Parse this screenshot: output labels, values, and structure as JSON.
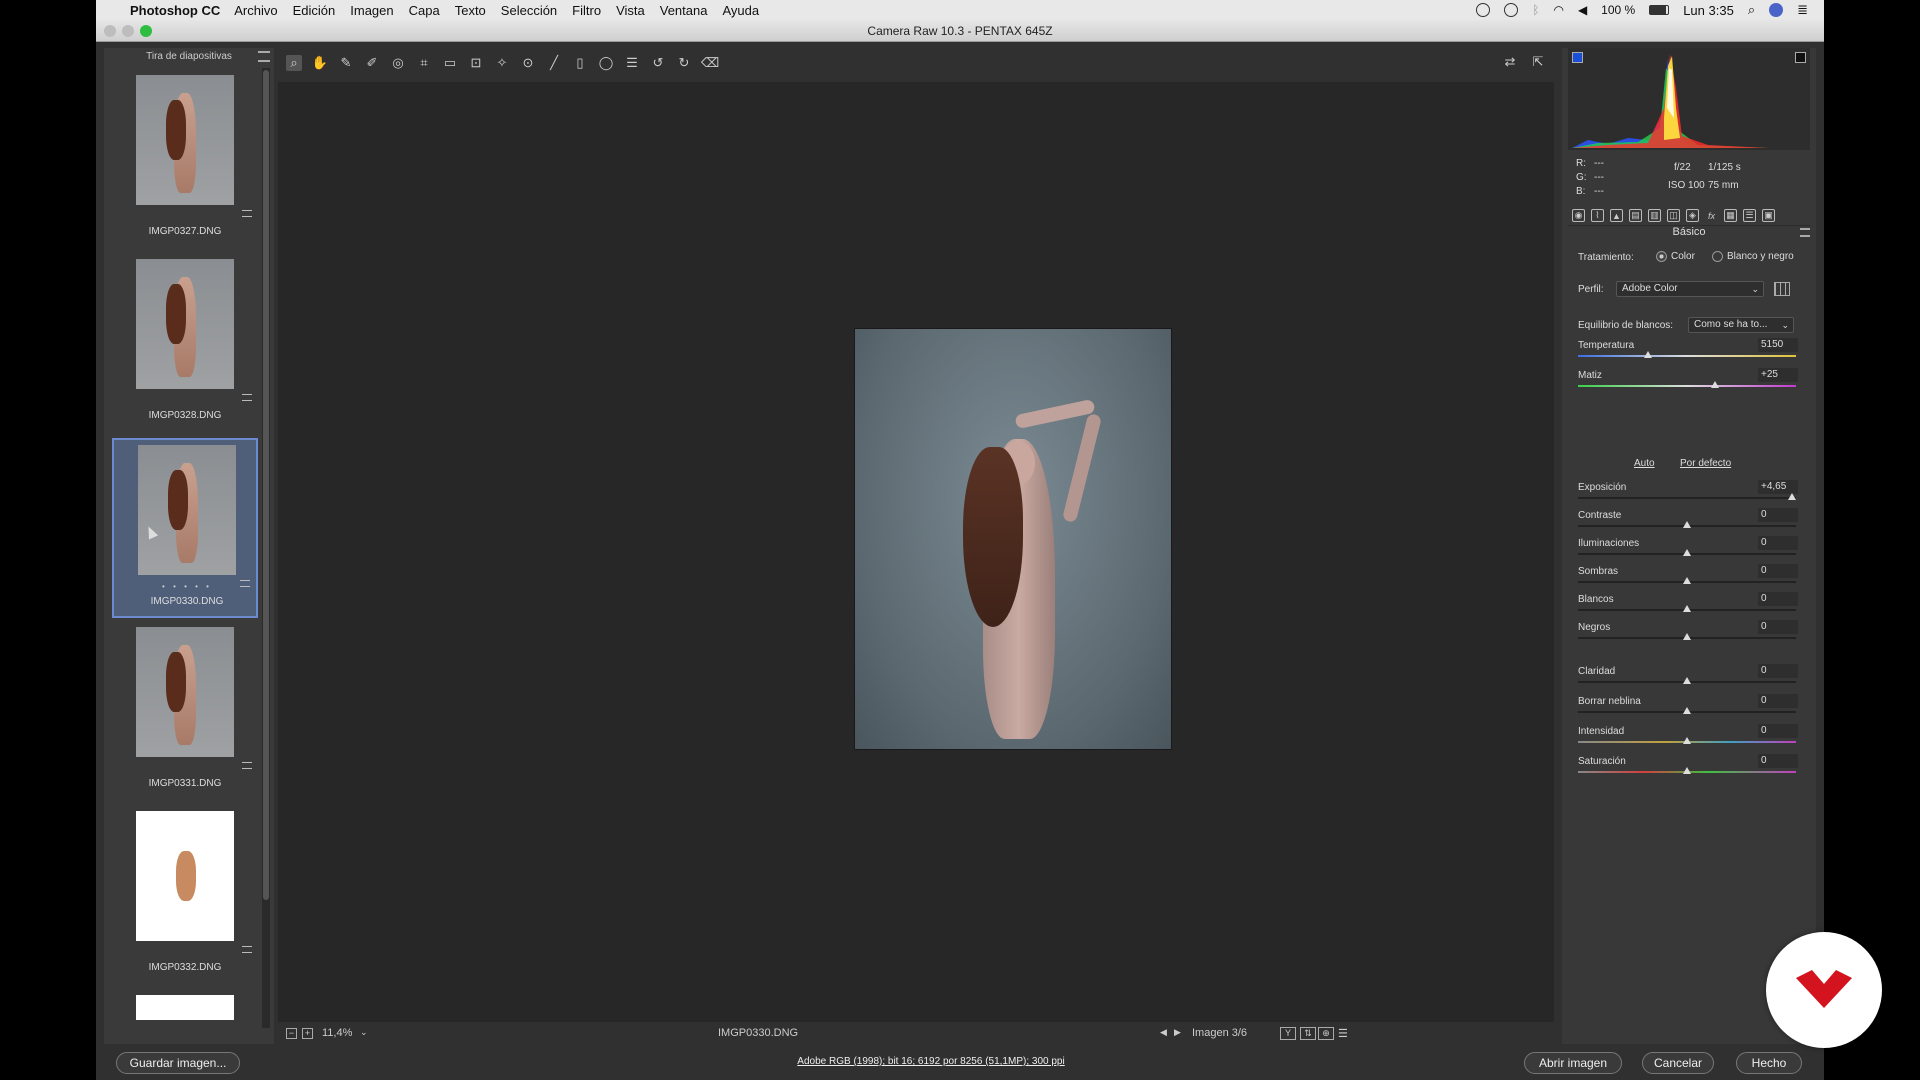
{
  "menubar": {
    "app": "Photoshop CC",
    "items": [
      "Archivo",
      "Edición",
      "Imagen",
      "Capa",
      "Texto",
      "Selección",
      "Filtro",
      "Vista",
      "Ventana",
      "Ayuda"
    ],
    "battery": "100 %",
    "clock": "Lun 3:35"
  },
  "window": {
    "title": "Camera Raw 10.3 -  PENTAX 645Z"
  },
  "filmstrip": {
    "title": "Tira de diapositivas",
    "items": [
      {
        "name": "IMGP0327.DNG"
      },
      {
        "name": "IMGP0328.DNG"
      },
      {
        "name": "IMGP0330.DNG",
        "stars": "• • • • •"
      },
      {
        "name": "IMGP0331.DNG"
      },
      {
        "name": "IMGP0332.DNG"
      }
    ]
  },
  "preview": {
    "zoom": "11,4%",
    "filename": "IMGP0330.DNG",
    "counter": "Imagen 3/6"
  },
  "info": {
    "r_label": "R:",
    "g_label": "G:",
    "b_label": "B:",
    "r": "---",
    "g": "---",
    "b": "---",
    "aperture": "f/22",
    "shutter": "1/125 s",
    "iso": "ISO 100",
    "focal": "75 mm"
  },
  "panel": {
    "title": "Básico",
    "treatment_label": "Tratamiento:",
    "treatment_color": "Color",
    "treatment_bw": "Blanco y negro",
    "profile_label": "Perfil:",
    "profile_value": "Adobe Color",
    "wb_label": "Equilibrio de blancos:",
    "wb_value": "Como se ha to...",
    "auto": "Auto",
    "default": "Por defecto",
    "sliders": [
      {
        "label": "Temperatura",
        "value": "5150",
        "pos": 0.32
      },
      {
        "label": "Matiz",
        "value": "+25",
        "pos": 0.63
      },
      {
        "label": "Exposición",
        "value": "+4,65",
        "pos": 0.98
      },
      {
        "label": "Contraste",
        "value": "0",
        "pos": 0.5
      },
      {
        "label": "Iluminaciones",
        "value": "0",
        "pos": 0.5
      },
      {
        "label": "Sombras",
        "value": "0",
        "pos": 0.5
      },
      {
        "label": "Blancos",
        "value": "0",
        "pos": 0.5
      },
      {
        "label": "Negros",
        "value": "0",
        "pos": 0.5
      },
      {
        "label": "Claridad",
        "value": "0",
        "pos": 0.5
      },
      {
        "label": "Borrar neblina",
        "value": "0",
        "pos": 0.5
      },
      {
        "label": "Intensidad",
        "value": "0",
        "pos": 0.5
      },
      {
        "label": "Saturación",
        "value": "0",
        "pos": 0.5
      }
    ]
  },
  "footer": {
    "save": "Guardar imagen...",
    "workflow": "Adobe RGB (1998); bit 16; 6192 por 8256 (51,1MP); 300 ppi",
    "open": "Abrir imagen",
    "cancel": "Cancelar",
    "done": "Hecho"
  },
  "colors": {
    "accent": "#6a8bd0",
    "logo": "#d3131d"
  }
}
